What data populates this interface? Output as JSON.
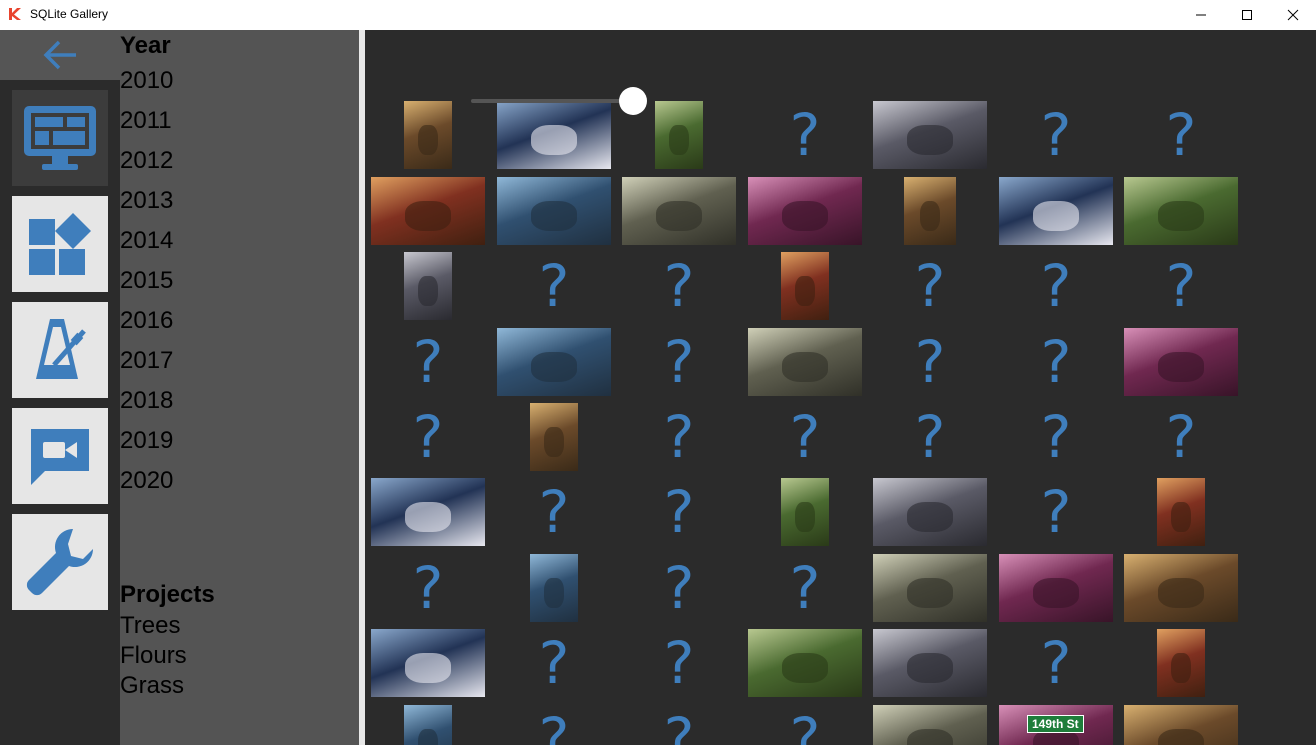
{
  "window": {
    "title": "SQLite Gallery"
  },
  "icons": {
    "back": "back-arrow-icon",
    "nav": [
      "monitor-icon",
      "dashboard-icon",
      "metronome-icon",
      "video-chat-icon",
      "wrench-icon"
    ],
    "missing": "question-mark-icon"
  },
  "colors": {
    "accent": "#3f7ebc",
    "background": "#2b2b2b",
    "panel": "#545454"
  },
  "filters": {
    "year_heading": "Year",
    "years": [
      "2010",
      "2011",
      "2012",
      "2013",
      "2014",
      "2015",
      "2016",
      "2017",
      "2018",
      "2019",
      "2020"
    ],
    "projects_heading": "Projects",
    "projects": [
      "Trees",
      "Flours",
      "Grass"
    ]
  },
  "gallery": {
    "slider_level": 0.95,
    "placeholder_glyph": "?",
    "street_sign_text": "149th St",
    "thumb_rows": [
      [
        "photo",
        "photo",
        "photo",
        "missing",
        "photo",
        "missing",
        "missing"
      ],
      [
        "photo",
        "photo",
        "photo",
        "photo",
        "photo",
        "photo",
        "photo"
      ],
      [
        "photo",
        "missing",
        "missing",
        "photo",
        "missing",
        "missing",
        "missing"
      ],
      [
        "missing",
        "photo",
        "missing",
        "photo",
        "missing",
        "missing",
        "photo"
      ],
      [
        "missing",
        "photo",
        "missing",
        "missing",
        "missing",
        "missing",
        "missing"
      ],
      [
        "photo",
        "missing",
        "missing",
        "photo",
        "photo",
        "missing",
        "photo"
      ],
      [
        "missing",
        "photo",
        "missing",
        "missing",
        "photo",
        "photo",
        "photo"
      ],
      [
        "photo",
        "missing",
        "missing",
        "photo",
        "photo",
        "missing",
        "photo"
      ],
      [
        "photo",
        "missing",
        "missing",
        "missing",
        "photo",
        "photo",
        "photo"
      ]
    ]
  }
}
